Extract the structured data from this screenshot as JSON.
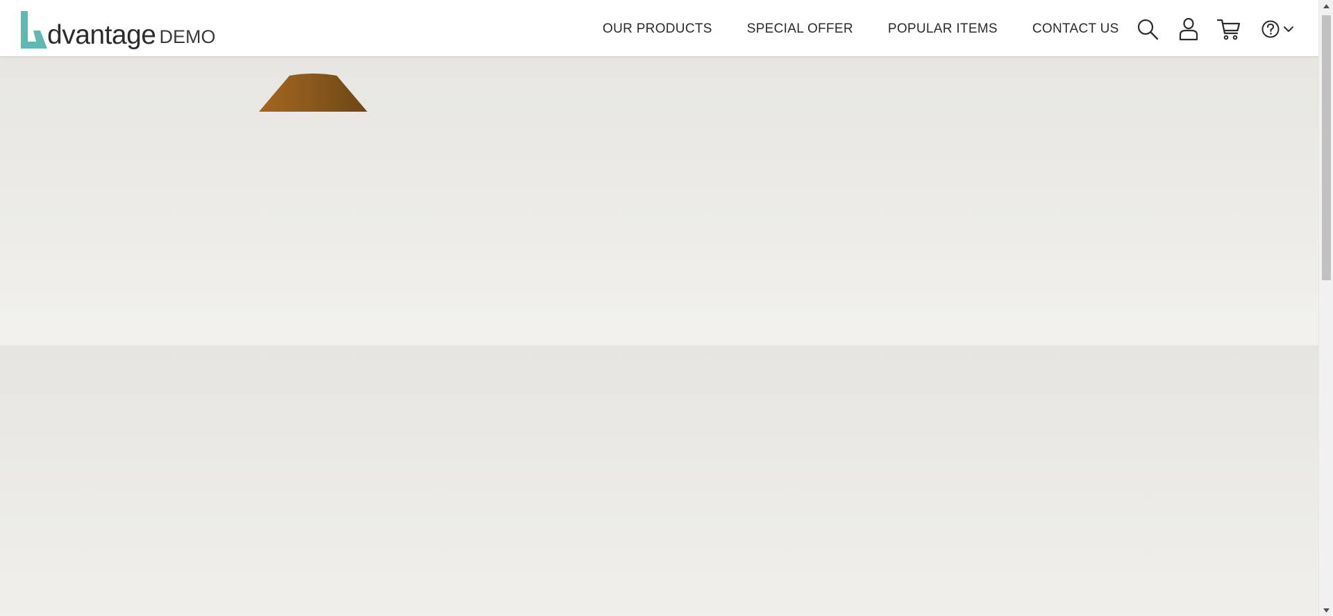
{
  "app": {
    "logo": {
      "word": "dvantage",
      "suffix": "DEMO",
      "accent_color": "#5fb9b0"
    }
  },
  "nav": {
    "items": [
      {
        "label": "OUR PRODUCTS"
      },
      {
        "label": "SPECIAL OFFER"
      },
      {
        "label": "POPULAR ITEMS"
      },
      {
        "label": "CONTACT US"
      }
    ]
  },
  "icons": {
    "search": "search-icon",
    "user": "user-icon",
    "cart": "cart-icon",
    "help": "help-icon",
    "help_menu": "chevron-down-icon"
  },
  "colors": {
    "header_bg": "#ffffff",
    "hero_bg": "#ebeae6",
    "lamp": "#8b5a1e",
    "text": "#2b2b2b"
  }
}
